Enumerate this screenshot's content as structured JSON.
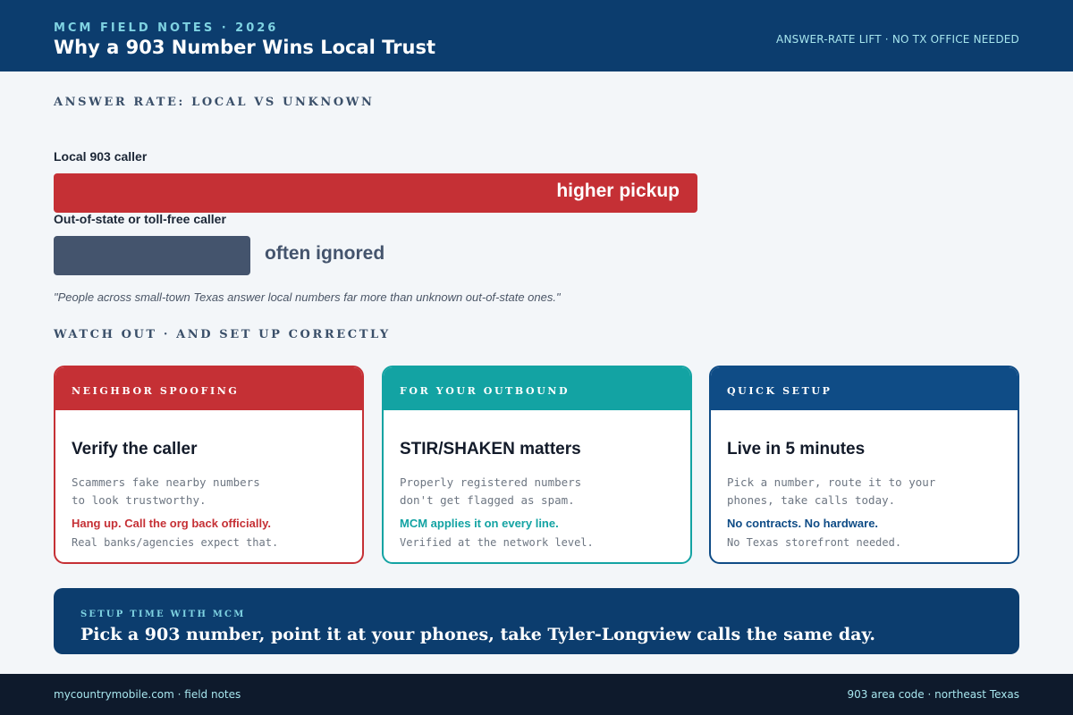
{
  "header": {
    "kicker": "MCM FIELD NOTES · 2026",
    "title": "Why a 903 Number Wins Local Trust",
    "tagline": "ANSWER-RATE LIFT · NO TX OFFICE NEEDED"
  },
  "answer_rate": {
    "heading": "ANSWER RATE: LOCAL VS UNKNOWN",
    "local": {
      "label": "Local 903 caller",
      "bar_text": "higher pickup"
    },
    "unknown": {
      "label": "Out-of-state or toll-free caller",
      "bar_text": "often ignored"
    },
    "quote": "\"People across small-town Texas answer local numbers far more than unknown out-of-state ones.\""
  },
  "watch_out": {
    "heading": "WATCH OUT · AND SET UP CORRECTLY",
    "cards": [
      {
        "header": "NEIGHBOR SPOOFING",
        "title": "Verify the caller",
        "body_line1": "Scammers fake nearby numbers",
        "body_line2": "to look trustworthy.",
        "emphasis": "Hang up. Call the org back officially.",
        "footnote": "Real banks/agencies expect that."
      },
      {
        "header": "FOR YOUR OUTBOUND",
        "title": "STIR/SHAKEN matters",
        "body_line1": "Properly registered numbers",
        "body_line2": "don't get flagged as spam.",
        "emphasis": "MCM applies it on every line.",
        "footnote": "Verified at the network level."
      },
      {
        "header": "QUICK SETUP",
        "title": "Live in 5 minutes",
        "body_line1": "Pick a number, route it to your",
        "body_line2": "phones, take calls today.",
        "emphasis": "No contracts. No hardware.",
        "footnote": "No Texas storefront needed."
      }
    ]
  },
  "banner": {
    "kicker": "SETUP TIME WITH MCM",
    "text": "Pick a 903 number, point it at your phones, take Tyler-Longview calls the same day."
  },
  "footer": {
    "left": "mycountrymobile.com · field notes",
    "right": "903 area code · northeast Texas"
  },
  "colors": {
    "navy": "#0c3d6e",
    "red": "#c53035",
    "teal": "#13a3a3",
    "blue": "#0f4c86",
    "slate": "#44546d"
  }
}
